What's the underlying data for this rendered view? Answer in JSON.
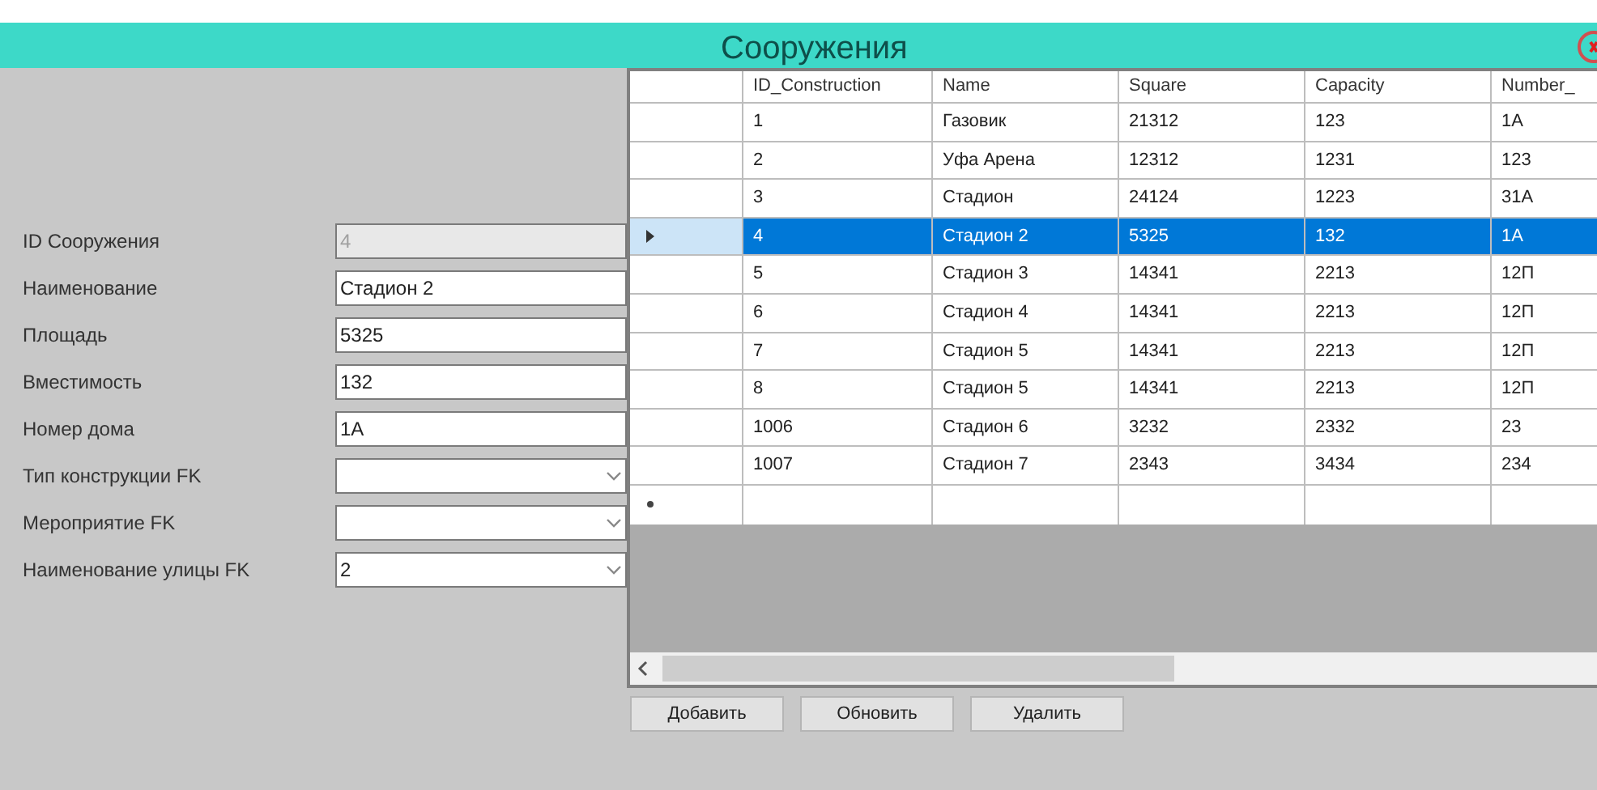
{
  "window": {
    "title": "Сооружения"
  },
  "form": {
    "fields": [
      {
        "label": "ID Сооружения",
        "kind": "text",
        "value": "4",
        "disabled": true
      },
      {
        "label": "Наименование",
        "kind": "text",
        "value": "Стадион 2",
        "disabled": false
      },
      {
        "label": "Площадь",
        "kind": "text",
        "value": "5325",
        "disabled": false
      },
      {
        "label": "Вместимость",
        "kind": "text",
        "value": "132",
        "disabled": false
      },
      {
        "label": "Номер дома",
        "kind": "text",
        "value": "1А",
        "disabled": false
      },
      {
        "label": "Тип конструкции FK",
        "kind": "combo",
        "disabled": false
      },
      {
        "label": "Мероприятие FK",
        "kind": "combo",
        "disabled": false
      },
      {
        "label": "Наименование улицы FK",
        "kind": "combo",
        "value": "2",
        "disabled": false
      }
    ]
  },
  "table": {
    "columns": [
      "ID_Construction",
      "Name",
      "Square",
      "Capacity",
      "Number_"
    ],
    "rows": [
      {
        "selected": false,
        "cells": [
          "1",
          "Газовик",
          "21312",
          "123",
          "1А"
        ]
      },
      {
        "selected": false,
        "cells": [
          "2",
          "Уфа Арена",
          "12312",
          "1231",
          "123"
        ]
      },
      {
        "selected": false,
        "cells": [
          "3",
          "Стадион",
          "24124",
          "1223",
          "31А"
        ]
      },
      {
        "selected": true,
        "cells": [
          "4",
          "Стадион 2",
          "5325",
          "132",
          "1А"
        ]
      },
      {
        "selected": false,
        "cells": [
          "5",
          "Стадион 3",
          "14341",
          "2213",
          "12П"
        ]
      },
      {
        "selected": false,
        "cells": [
          "6",
          "Стадион 4",
          "14341",
          "2213",
          "12П"
        ]
      },
      {
        "selected": false,
        "cells": [
          "7",
          "Стадион 5",
          "14341",
          "2213",
          "12П"
        ]
      },
      {
        "selected": false,
        "cells": [
          "8",
          "Стадион 5",
          "14341",
          "2213",
          "12П"
        ]
      },
      {
        "selected": false,
        "cells": [
          "1006",
          "Стадион 6",
          "3232",
          "2332",
          "23"
        ]
      },
      {
        "selected": false,
        "cells": [
          "1007",
          "Стадион 7",
          "2343",
          "3434",
          "234"
        ]
      }
    ]
  },
  "buttons": [
    "Добавить",
    "Обновить",
    "Удалить"
  ]
}
